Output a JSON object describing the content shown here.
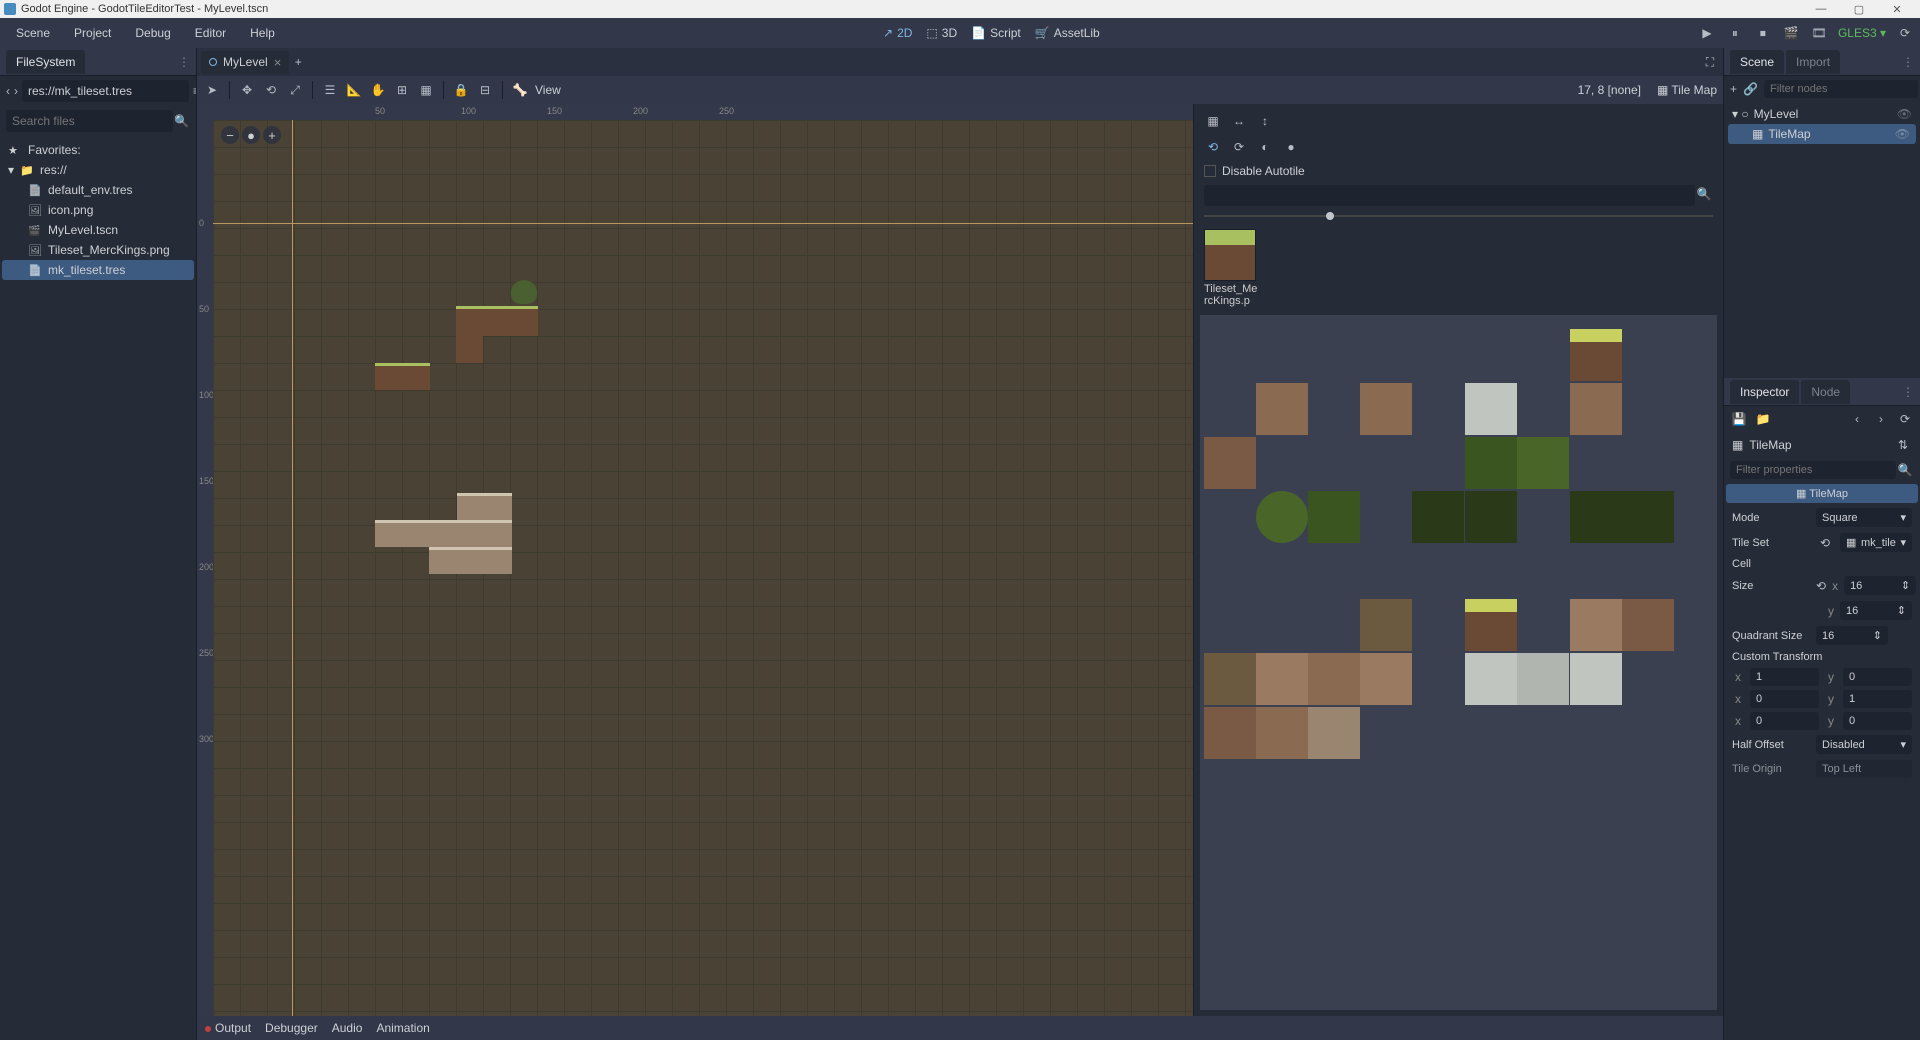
{
  "window": {
    "title": "Godot Engine - GodotTileEditorTest - MyLevel.tscn"
  },
  "menubar": {
    "items": [
      "Scene",
      "Project",
      "Debug",
      "Editor",
      "Help"
    ],
    "modes": {
      "d2": "2D",
      "d3": "3D",
      "script": "Script",
      "assetlib": "AssetLib"
    },
    "renderer": "GLES3"
  },
  "filesystem": {
    "title": "FileSystem",
    "path": "res://mk_tileset.tres",
    "search_placeholder": "Search files",
    "favorites": "Favorites:",
    "root": "res://",
    "files": [
      {
        "name": "default_env.tres",
        "icon": "file"
      },
      {
        "name": "icon.png",
        "icon": "img"
      },
      {
        "name": "MyLevel.tscn",
        "icon": "scene"
      },
      {
        "name": "Tileset_MercKings.png",
        "icon": "img"
      },
      {
        "name": "mk_tileset.tres",
        "icon": "file",
        "selected": true
      }
    ]
  },
  "scene_tab": {
    "name": "MyLevel"
  },
  "toolbar": {
    "view": "View",
    "status": "17, 8 [none]",
    "context": "Tile Map"
  },
  "rulers": {
    "h": [
      "50",
      "100",
      "150",
      "200",
      "250"
    ],
    "v": [
      "0",
      "50",
      "100",
      "150",
      "200",
      "250",
      "300"
    ]
  },
  "tileset": {
    "disable_autotile": "Disable Autotile",
    "thumb_name": "Tileset_MercKings.p"
  },
  "scene_dock": {
    "tab1": "Scene",
    "tab2": "Import",
    "filter_placeholder": "Filter nodes",
    "root": "MyLevel",
    "child": "TileMap"
  },
  "inspector": {
    "tab1": "Inspector",
    "tab2": "Node",
    "type": "TileMap",
    "filter_placeholder": "Filter properties",
    "section": "TileMap",
    "props": {
      "mode_label": "Mode",
      "mode_value": "Square",
      "tileset_label": "Tile Set",
      "tileset_value": "mk_tile",
      "cell_label": "Cell",
      "size_label": "Size",
      "size_x": "16",
      "size_y": "16",
      "quadrant_label": "Quadrant Size",
      "quadrant_value": "16",
      "custom_transform_label": "Custom Transform",
      "ct_r0_x": "1",
      "ct_r0_y": "0",
      "ct_r1_x": "0",
      "ct_r1_y": "1",
      "ct_r2_x": "0",
      "ct_r2_y": "0",
      "half_offset_label": "Half Offset",
      "half_offset_value": "Disabled",
      "tile_origin_label": "Tile Origin",
      "tile_origin_value": "Top Left"
    }
  },
  "bottom": {
    "output": "Output",
    "debugger": "Debugger",
    "audio": "Audio",
    "animation": "Animation"
  }
}
